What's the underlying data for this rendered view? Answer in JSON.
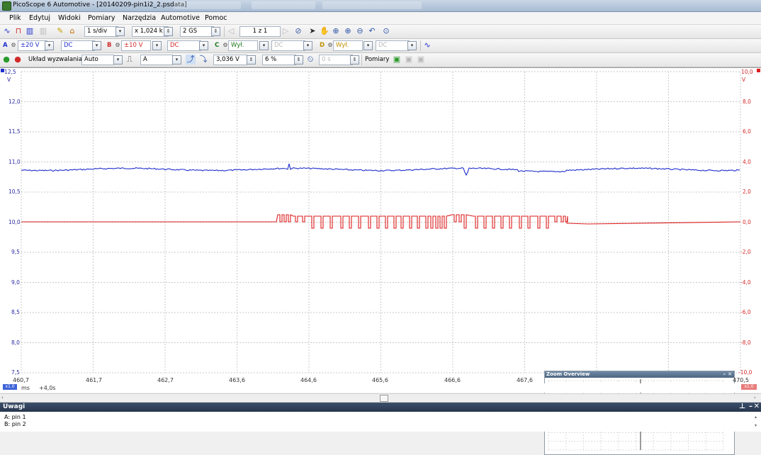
{
  "window": {
    "title": "PicoScope 6 Automotive - [20140209-pin1i2_2.psdata]"
  },
  "menu": [
    "Plik",
    "Edytuj",
    "Widoki",
    "Pomiary",
    "Narzędzia",
    "Automotive",
    "Pomoc"
  ],
  "toolbar1": {
    "timebase": "1 s/div",
    "zoom": "x 1,024 k",
    "samples": "2 GS",
    "page": "1 z 1"
  },
  "toolbar2": {
    "ch_a": {
      "label": "A",
      "range": "±20 V",
      "coupling": "DC"
    },
    "ch_b": {
      "label": "B",
      "range": "±10 V",
      "coupling": "DC"
    },
    "ch_c": {
      "label": "C",
      "range": "Wył.",
      "coupling": "DC"
    },
    "ch_d": {
      "label": "D",
      "range": "Wył.",
      "coupling": "DC"
    }
  },
  "toolbar3": {
    "trigger_label": "Układ wyzwalania",
    "trigger_mode": "Auto",
    "trigger_source": "A",
    "threshold": "3,036 V",
    "pretrigger": "6 %",
    "delay": "0 s",
    "measurements": "Pomiary"
  },
  "plot": {
    "left_axis": [
      "12,5",
      "12,0",
      "11,5",
      "11,0",
      "10,5",
      "10,0",
      "9,5",
      "9,0",
      "8,5",
      "8,0",
      "7,5"
    ],
    "left_unit": "V",
    "right_axis": [
      "10,0",
      "8,0",
      "6,0",
      "4,0",
      "2,0",
      "0,0",
      "-2,0",
      "-4,0",
      "-6,0",
      "-8,0",
      "-10,0"
    ],
    "right_unit": "V",
    "x_axis": [
      "460,7",
      "461,7",
      "462,7",
      "463,6",
      "464,6",
      "465,6",
      "466,6",
      "467,6",
      "470,5"
    ],
    "x_unit": "ms",
    "x_offset": "+4,0s",
    "left_badge": "x1.0",
    "right_badge": "x1.0",
    "colors": {
      "a": "#1f2ecc",
      "b": "#dd1e1e",
      "grid": "#c9c9c9"
    }
  },
  "zoom_overview": {
    "title": "Zoom Overview"
  },
  "notes": {
    "title": "Uwagi",
    "lines": [
      "A: pin 1",
      "B: pin 2"
    ]
  }
}
